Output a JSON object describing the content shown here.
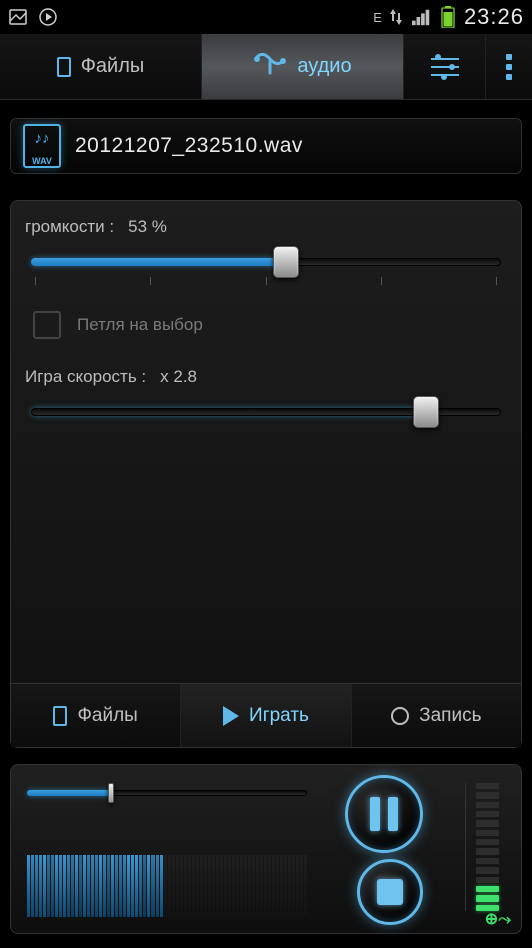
{
  "status": {
    "edge_label": "E",
    "time": "23:26"
  },
  "top_tabs": {
    "files": "Файлы",
    "audio": "аудио"
  },
  "track": {
    "filename": "20121207_232510.wav",
    "icon_label": "WAV"
  },
  "controls": {
    "volume_label": "громкости :",
    "volume_value": "53 %",
    "volume_percent": 53,
    "loop_label": "Петля на выбор",
    "loop_checked": false,
    "speed_label": "Игра скорость :",
    "speed_value": "x 2.8",
    "speed_percent": 82
  },
  "bottom_tabs": {
    "files": "Файлы",
    "play": "Играть",
    "record": "Запись"
  },
  "player": {
    "progress_percent": 30,
    "level_active_segments": 3,
    "level_total_segments": 14
  }
}
